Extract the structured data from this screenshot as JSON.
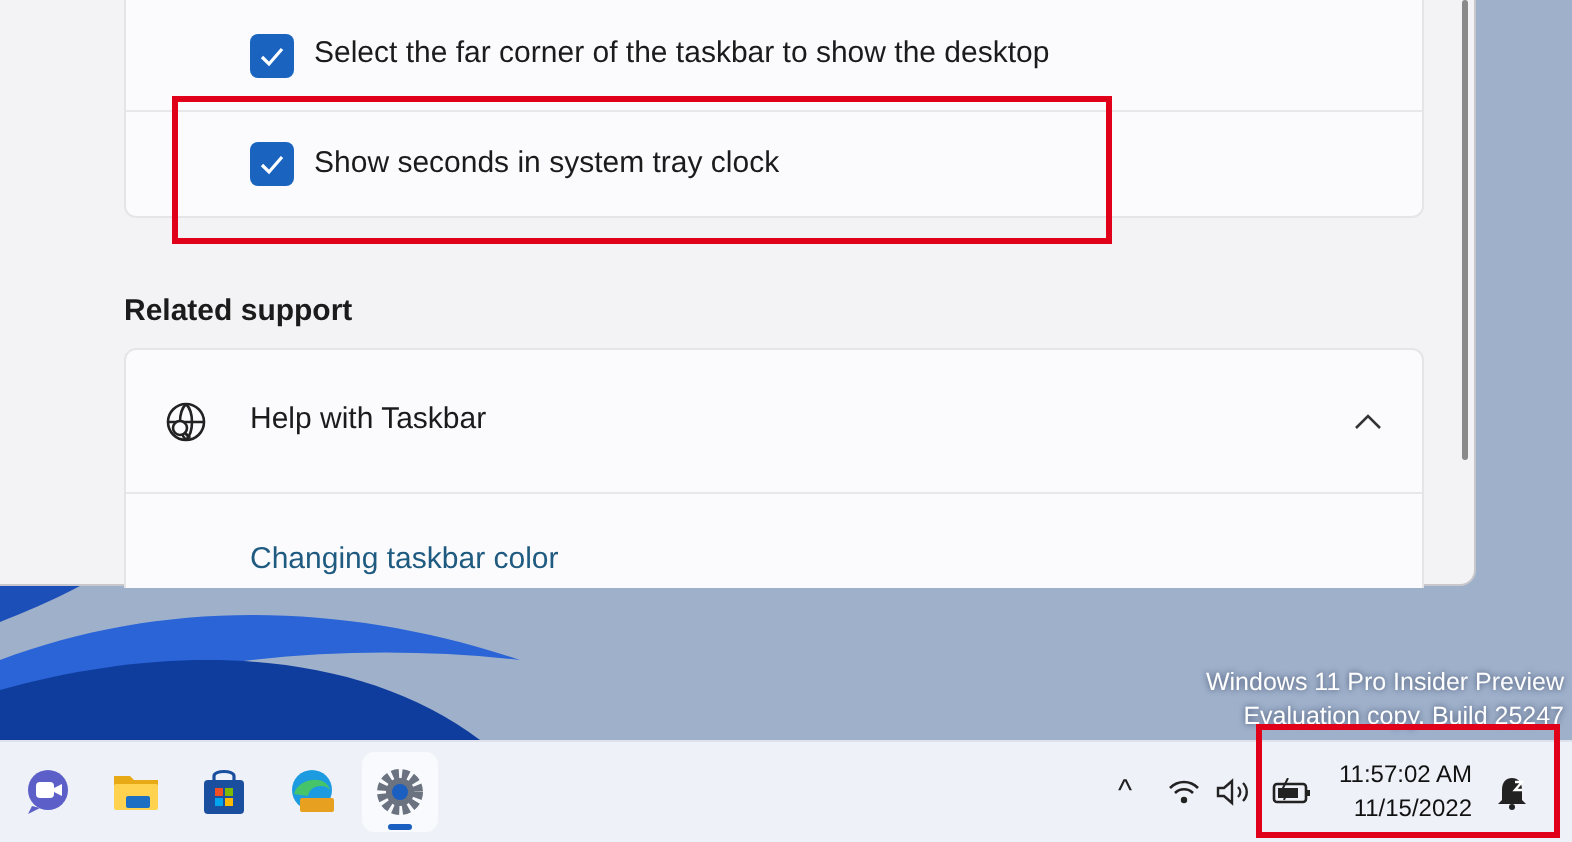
{
  "settings": [
    {
      "label": "Select the far corner of the taskbar to show the desktop",
      "checked": true,
      "highlighted": false
    },
    {
      "label": "Show seconds in system tray clock",
      "checked": true,
      "highlighted": true
    }
  ],
  "related_support": {
    "heading": "Related support",
    "title": "Help with Taskbar",
    "expanded": true,
    "links": [
      "Changing taskbar color"
    ]
  },
  "watermark_text": [
    "Windows 11 Pro Insider Preview",
    "Evaluation copy. Build 25247"
  ],
  "taskbar": {
    "apps": [
      {
        "kind": "chat",
        "selected": false
      },
      {
        "kind": "folder",
        "selected": false
      },
      {
        "kind": "store",
        "selected": false
      },
      {
        "kind": "edge",
        "selected": false
      },
      {
        "kind": "settings",
        "selected": true
      }
    ],
    "tray_arrow": "^",
    "clock": {
      "time": "11:57:02 AM",
      "date": "11/15/2022",
      "highlighted": true
    }
  }
}
